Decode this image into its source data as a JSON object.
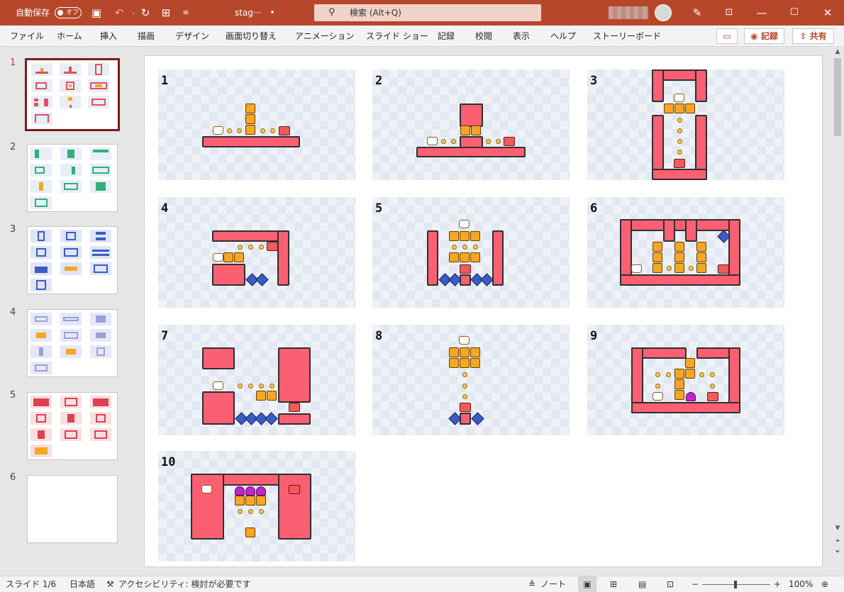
{
  "titlebar": {
    "autosave_label": "自動保存",
    "autosave_state": "オフ",
    "doc_title": "stag···",
    "search_placeholder": "検索 (Alt+Q)"
  },
  "ribbon_tabs": [
    "ファイル",
    "ホーム",
    "挿入",
    "描画",
    "デザイン",
    "画面切り替え",
    "アニメーション",
    "スライド ショー",
    "記録",
    "校閲",
    "表示",
    "ヘルプ",
    "ストーリーボード"
  ],
  "ribbon_actions": {
    "record_label": "記録",
    "share_label": "共有"
  },
  "thumbnails": [
    "1",
    "2",
    "3",
    "4",
    "5",
    "6"
  ],
  "stages": [
    "1",
    "2",
    "3",
    "4",
    "5",
    "6",
    "7",
    "8",
    "9",
    "10"
  ],
  "statusbar": {
    "slide_info": "スライド 1/6",
    "language": "日本語",
    "accessibility": "アクセシビリティ: 検討が必要です",
    "notes": "ノート",
    "zoom": "100%"
  },
  "colors": {
    "accent": "#b7472a",
    "wall": "#fa6072",
    "block": "#f5a623",
    "selected_border": "#7a1c1c"
  }
}
